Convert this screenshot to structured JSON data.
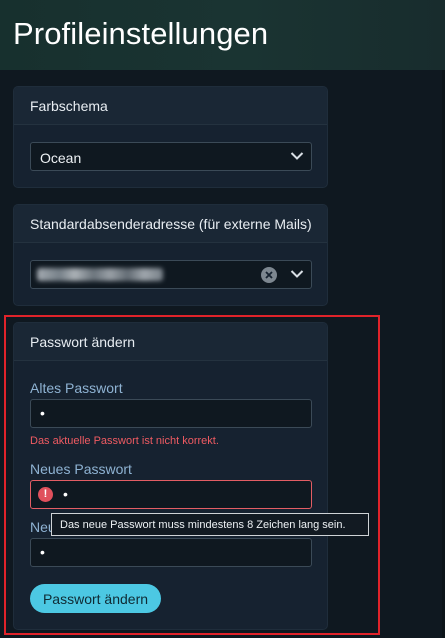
{
  "page": {
    "title": "Profileinstellungen"
  },
  "color_scheme": {
    "title": "Farbschema",
    "selected": "Ocean"
  },
  "default_sender": {
    "title": "Standardabsenderadresse (für externe Mails)",
    "value_redacted": true
  },
  "password": {
    "title": "Passwort ändern",
    "old_label": "Altes Passwort",
    "old_value": "•",
    "old_error": "Das aktuelle Passwort ist nicht korrekt.",
    "new_label": "Neues Passwort",
    "new_value": "•",
    "confirm_label_partial": "Neu",
    "confirm_value": "•",
    "tooltip": "Das neue Passwort muss mindestens 8 Zeichen lang sein.",
    "submit_label": "Passwort ändern",
    "error_icon_glyph": "!"
  },
  "colors": {
    "accent": "#4cc8e3",
    "error": "#ef5b62",
    "highlight_frame": "#e0232a"
  },
  "icons": {
    "dropdown": "chevron-down-icon",
    "clear": "clear-icon",
    "error": "exclamation-circle-icon"
  }
}
